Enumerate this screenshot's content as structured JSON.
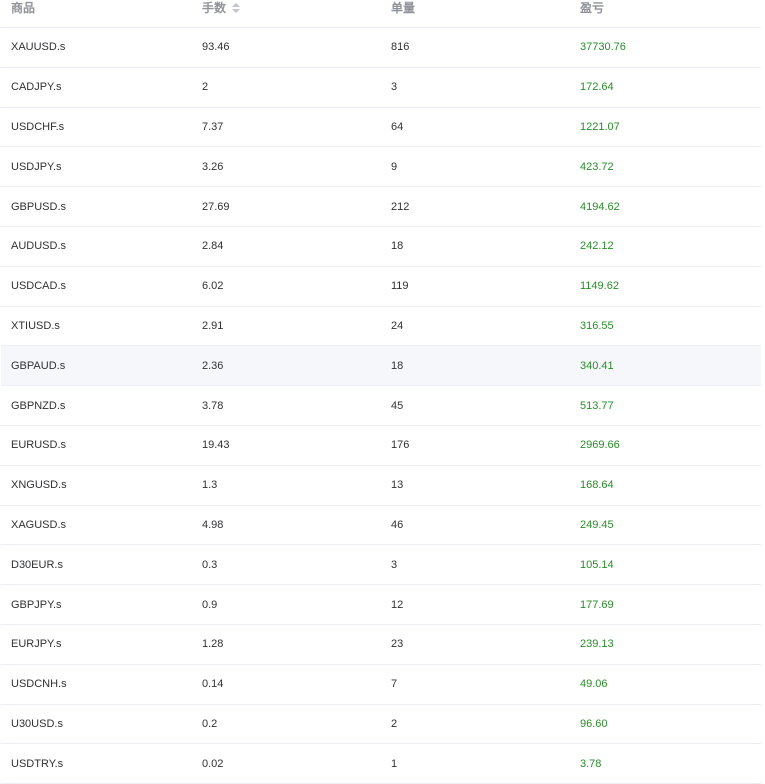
{
  "columns": [
    {
      "label": "商品"
    },
    {
      "label": "手数",
      "sortable": true
    },
    {
      "label": "单量"
    },
    {
      "label": "盈亏"
    }
  ],
  "rows": [
    {
      "symbol": "XAUUSD.s",
      "lots": "93.46",
      "orders": "816",
      "pnl": "37730.76"
    },
    {
      "symbol": "CADJPY.s",
      "lots": "2",
      "orders": "3",
      "pnl": "172.64"
    },
    {
      "symbol": "USDCHF.s",
      "lots": "7.37",
      "orders": "64",
      "pnl": "1221.07"
    },
    {
      "symbol": "USDJPY.s",
      "lots": "3.26",
      "orders": "9",
      "pnl": "423.72"
    },
    {
      "symbol": "GBPUSD.s",
      "lots": "27.69",
      "orders": "212",
      "pnl": "4194.62"
    },
    {
      "symbol": "AUDUSD.s",
      "lots": "2.84",
      "orders": "18",
      "pnl": "242.12"
    },
    {
      "symbol": "USDCAD.s",
      "lots": "6.02",
      "orders": "119",
      "pnl": "1149.62"
    },
    {
      "symbol": "XTIUSD.s",
      "lots": "2.91",
      "orders": "24",
      "pnl": "316.55"
    },
    {
      "symbol": "GBPAUD.s",
      "lots": "2.36",
      "orders": "18",
      "pnl": "340.41",
      "hover": true
    },
    {
      "symbol": "GBPNZD.s",
      "lots": "3.78",
      "orders": "45",
      "pnl": "513.77"
    },
    {
      "symbol": "EURUSD.s",
      "lots": "19.43",
      "orders": "176",
      "pnl": "2969.66"
    },
    {
      "symbol": "XNGUSD.s",
      "lots": "1.3",
      "orders": "13",
      "pnl": "168.64"
    },
    {
      "symbol": "XAGUSD.s",
      "lots": "4.98",
      "orders": "46",
      "pnl": "249.45"
    },
    {
      "symbol": "D30EUR.s",
      "lots": "0.3",
      "orders": "3",
      "pnl": "105.14"
    },
    {
      "symbol": "GBPJPY.s",
      "lots": "0.9",
      "orders": "12",
      "pnl": "177.69"
    },
    {
      "symbol": "EURJPY.s",
      "lots": "1.28",
      "orders": "23",
      "pnl": "239.13"
    },
    {
      "symbol": "USDCNH.s",
      "lots": "0.14",
      "orders": "7",
      "pnl": "49.06"
    },
    {
      "symbol": "U30USD.s",
      "lots": "0.2",
      "orders": "2",
      "pnl": "96.60"
    },
    {
      "symbol": "USDTRY.s",
      "lots": "0.02",
      "orders": "1",
      "pnl": "3.78"
    }
  ],
  "colors": {
    "profit": "#2a8c2a",
    "hover_row": "#f5f7fa",
    "border": "#ebeef5"
  }
}
